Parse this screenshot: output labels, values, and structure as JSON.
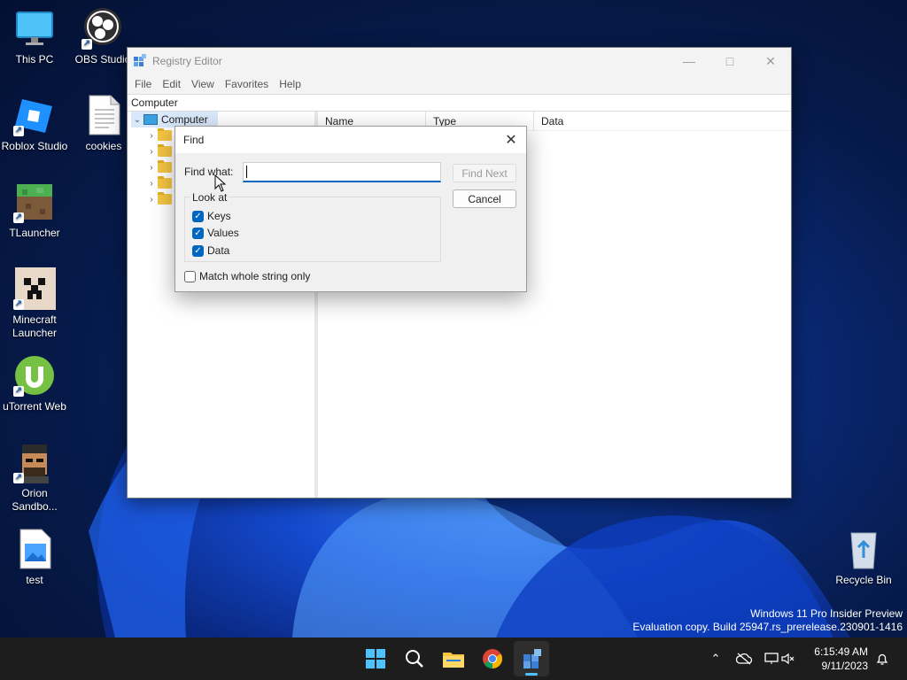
{
  "desktop": {
    "icons": [
      {
        "label": "This PC"
      },
      {
        "label": "OBS Studio"
      },
      {
        "label": "Roblox Studio"
      },
      {
        "label": "cookies"
      },
      {
        "label": "TLauncher"
      },
      {
        "label": "Minecraft Launcher"
      },
      {
        "label": "uTorrent Web"
      },
      {
        "label": "Orion Sandbo..."
      },
      {
        "label": "test"
      },
      {
        "label": "Recycle Bin"
      }
    ]
  },
  "regedit": {
    "title": "Registry Editor",
    "menu": [
      "File",
      "Edit",
      "View",
      "Favorites",
      "Help"
    ],
    "address": "Computer",
    "tree_root": "Computer",
    "columns": [
      "Name",
      "Type",
      "Data"
    ]
  },
  "find_dialog": {
    "title": "Find",
    "find_what_label": "Find what:",
    "find_what_value": "",
    "find_next_label": "Find Next",
    "cancel_label": "Cancel",
    "look_at_label": "Look at",
    "options": [
      {
        "label": "Keys",
        "checked": true
      },
      {
        "label": "Values",
        "checked": true
      },
      {
        "label": "Data",
        "checked": true
      }
    ],
    "match_whole_label": "Match whole string only",
    "match_whole_checked": false
  },
  "watermark": {
    "line1": "Windows 11 Pro Insider Preview",
    "line2": "Evaluation copy. Build 25947.rs_prerelease.230901-1416"
  },
  "taskbar": {
    "time": "6:15:49 AM",
    "date": "9/11/2023",
    "apps": [
      "start-icon",
      "search-icon",
      "file-explorer-icon",
      "chrome-icon",
      "registry-editor-icon"
    ]
  },
  "colors": {
    "accent": "#0067c0",
    "taskbar": "#1d1d1d"
  }
}
